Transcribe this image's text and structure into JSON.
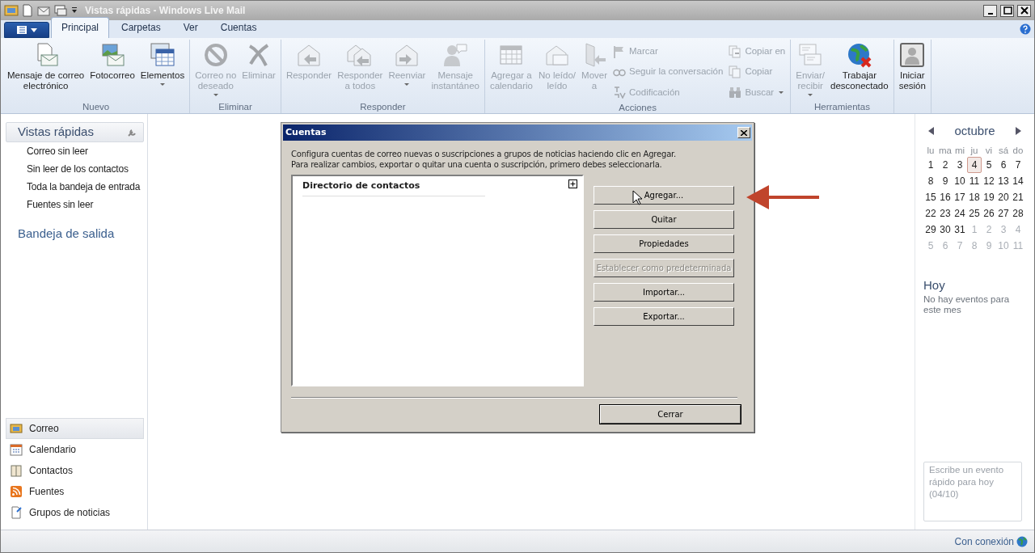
{
  "window": {
    "title": "Vistas rápidas - Windows Live Mail"
  },
  "tabs": [
    {
      "label": "Principal",
      "selected": true
    },
    {
      "label": "Carpetas",
      "selected": false
    },
    {
      "label": "Ver",
      "selected": false
    },
    {
      "label": "Cuentas",
      "selected": false
    }
  ],
  "ribbon": {
    "groups": [
      {
        "label": "Nuevo",
        "items": [
          {
            "kind": "large",
            "label": "Mensaje de correo\nelectrónico",
            "disabled": false,
            "dropdown": false
          },
          {
            "kind": "large",
            "label": "Fotocorreo",
            "disabled": false,
            "dropdown": false
          },
          {
            "kind": "large",
            "label": "Elementos",
            "disabled": false,
            "dropdown": true
          }
        ]
      },
      {
        "label": "Eliminar",
        "items": [
          {
            "kind": "large",
            "label": "Correo no\ndeseado",
            "disabled": true,
            "dropdown": true
          },
          {
            "kind": "large",
            "label": "Eliminar",
            "disabled": true,
            "dropdown": false
          }
        ]
      },
      {
        "label": "Responder",
        "items": [
          {
            "kind": "large",
            "label": "Responder",
            "disabled": true,
            "dropdown": false
          },
          {
            "kind": "large",
            "label": "Responder\na todos",
            "disabled": true,
            "dropdown": false
          },
          {
            "kind": "large",
            "label": "Reenviar",
            "disabled": true,
            "dropdown": true
          },
          {
            "kind": "large",
            "label": "Mensaje\ninstantáneo",
            "disabled": true,
            "dropdown": false
          }
        ]
      },
      {
        "label": "Acciones",
        "items": [
          {
            "kind": "large",
            "label": "Agregar a\ncalendario",
            "disabled": true,
            "dropdown": false
          },
          {
            "kind": "large",
            "label": "No leído/\nleído",
            "disabled": true,
            "dropdown": false
          },
          {
            "kind": "large",
            "label": "Mover\na",
            "disabled": true,
            "dropdown": false
          },
          {
            "kind": "small",
            "label": "Marcar",
            "disabled": true,
            "dropdown": false
          },
          {
            "kind": "small",
            "label": "Seguir la conversación",
            "disabled": true,
            "dropdown": false
          },
          {
            "kind": "small",
            "label": "Codificación",
            "disabled": true,
            "dropdown": false
          },
          {
            "kind": "small",
            "label": "Copiar en",
            "disabled": true,
            "dropdown": false
          },
          {
            "kind": "small",
            "label": "Copiar",
            "disabled": true,
            "dropdown": false
          },
          {
            "kind": "small",
            "label": "Buscar",
            "disabled": true,
            "dropdown": true
          }
        ]
      },
      {
        "label": "Herramientas",
        "items": [
          {
            "kind": "large",
            "label": "Enviar/\nrecibir",
            "disabled": true,
            "dropdown": true
          },
          {
            "kind": "large",
            "label": "Trabajar\ndesconectado",
            "disabled": false,
            "dropdown": false
          }
        ]
      },
      {
        "items": [
          {
            "kind": "large",
            "label": "Iniciar\nsesión",
            "disabled": false,
            "dropdown": false
          }
        ]
      }
    ]
  },
  "sidebar": {
    "header": "Vistas rápidas",
    "items": [
      {
        "label": "Correo sin leer"
      },
      {
        "label": "Sin leer de los contactos"
      },
      {
        "label": "Toda la bandeja de entrada"
      },
      {
        "label": "Fuentes sin leer"
      }
    ],
    "outbox": "Bandeja de salida",
    "nav": [
      {
        "label": "Correo",
        "selected": true
      },
      {
        "label": "Calendario",
        "selected": false
      },
      {
        "label": "Contactos",
        "selected": false
      },
      {
        "label": "Fuentes",
        "selected": false
      },
      {
        "label": "Grupos de noticias",
        "selected": false
      }
    ]
  },
  "dialog": {
    "title": "Cuentas",
    "lines": [
      "Configura cuentas de correo nuevas o suscripciones a grupos de noticias haciendo clic en Agregar.",
      "Para realizar cambios, exportar o quitar una cuenta o suscripción, primero debes seleccionarla."
    ],
    "list_header": "Directorio de contactos",
    "buttons": [
      {
        "label": "Agregar...",
        "disabled": false
      },
      {
        "label": "Quitar",
        "disabled": false
      },
      {
        "label": "Propiedades",
        "disabled": false
      },
      {
        "label": "Establecer como predeterminada",
        "disabled": true
      },
      {
        "label": "Importar...",
        "disabled": false
      },
      {
        "label": "Exportar...",
        "disabled": false
      }
    ],
    "close_button": "Cerrar"
  },
  "calendar": {
    "month": "octubre",
    "weekdays": [
      "lu",
      "ma",
      "mi",
      "ju",
      "vi",
      "sá",
      "do"
    ],
    "weeks": [
      [
        {
          "day": "1",
          "other_month": false,
          "selected": false
        },
        {
          "day": "2",
          "other_month": false,
          "selected": false
        },
        {
          "day": "3",
          "other_month": false,
          "selected": false
        },
        {
          "day": "4",
          "other_month": false,
          "selected": true
        },
        {
          "day": "5",
          "other_month": false,
          "selected": false
        },
        {
          "day": "6",
          "other_month": false,
          "selected": false
        },
        {
          "day": "7",
          "other_month": false,
          "selected": false
        }
      ],
      [
        {
          "day": "8",
          "other_month": false,
          "selected": false
        },
        {
          "day": "9",
          "other_month": false,
          "selected": false
        },
        {
          "day": "10",
          "other_month": false,
          "selected": false
        },
        {
          "day": "11",
          "other_month": false,
          "selected": false
        },
        {
          "day": "12",
          "other_month": false,
          "selected": false
        },
        {
          "day": "13",
          "other_month": false,
          "selected": false
        },
        {
          "day": "14",
          "other_month": false,
          "selected": false
        }
      ],
      [
        {
          "day": "15",
          "other_month": false,
          "selected": false
        },
        {
          "day": "16",
          "other_month": false,
          "selected": false
        },
        {
          "day": "17",
          "other_month": false,
          "selected": false
        },
        {
          "day": "18",
          "other_month": false,
          "selected": false
        },
        {
          "day": "19",
          "other_month": false,
          "selected": false
        },
        {
          "day": "20",
          "other_month": false,
          "selected": false
        },
        {
          "day": "21",
          "other_month": false,
          "selected": false
        }
      ],
      [
        {
          "day": "22",
          "other_month": false,
          "selected": false
        },
        {
          "day": "23",
          "other_month": false,
          "selected": false
        },
        {
          "day": "24",
          "other_month": false,
          "selected": false
        },
        {
          "day": "25",
          "other_month": false,
          "selected": false
        },
        {
          "day": "26",
          "other_month": false,
          "selected": false
        },
        {
          "day": "27",
          "other_month": false,
          "selected": false
        },
        {
          "day": "28",
          "other_month": false,
          "selected": false
        }
      ],
      [
        {
          "day": "29",
          "other_month": false,
          "selected": false
        },
        {
          "day": "30",
          "other_month": false,
          "selected": false
        },
        {
          "day": "31",
          "other_month": false,
          "selected": false
        },
        {
          "day": "1",
          "other_month": true,
          "selected": false
        },
        {
          "day": "2",
          "other_month": true,
          "selected": false
        },
        {
          "day": "3",
          "other_month": true,
          "selected": false
        },
        {
          "day": "4",
          "other_month": true,
          "selected": false
        }
      ],
      [
        {
          "day": "5",
          "other_month": true,
          "selected": false
        },
        {
          "day": "6",
          "other_month": true,
          "selected": false
        },
        {
          "day": "7",
          "other_month": true,
          "selected": false
        },
        {
          "day": "8",
          "other_month": true,
          "selected": false
        },
        {
          "day": "9",
          "other_month": true,
          "selected": false
        },
        {
          "day": "10",
          "other_month": true,
          "selected": false
        },
        {
          "day": "11",
          "other_month": true,
          "selected": false
        }
      ]
    ],
    "today_title": "Hoy",
    "today_text": "No hay eventos para este mes",
    "quick_event": {
      "placeholder": "Escribe un evento rápido para hoy (04/10)"
    }
  },
  "status_bar": {
    "text": "Con conexión"
  }
}
